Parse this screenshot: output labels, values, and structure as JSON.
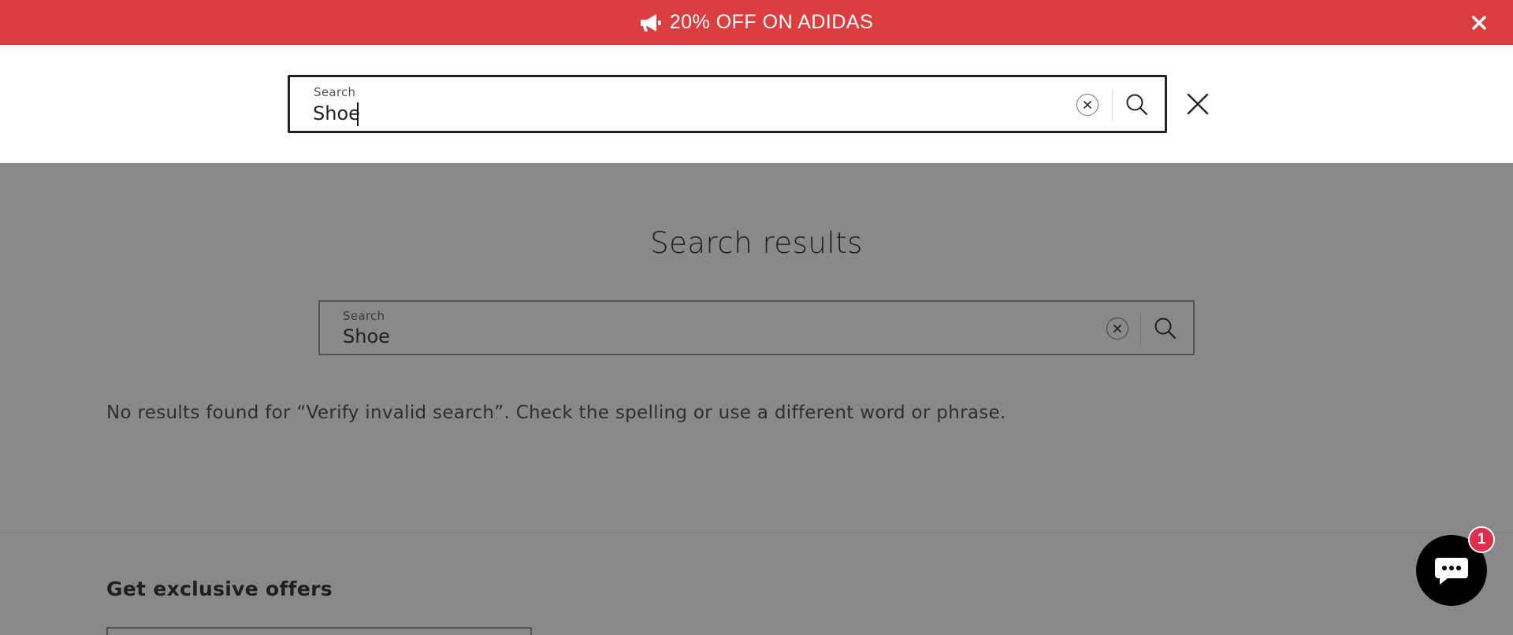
{
  "announcement": {
    "text": "20% OFF ON ADIDAS",
    "background": "#dc3e40",
    "icon": "megaphone-icon",
    "close_icon": "close-icon"
  },
  "header_search": {
    "label": "Search",
    "value": "Shoe",
    "clear_icon": "clear-circle-icon",
    "submit_icon": "search-icon",
    "close_icon": "close-icon"
  },
  "results": {
    "title": "Search results",
    "search": {
      "label": "Search",
      "value": "Shoe",
      "clear_icon": "clear-circle-icon",
      "submit_icon": "search-icon"
    },
    "message": "No results found for “Verify invalid search”. Check the spelling or use a different word or phrase."
  },
  "footer": {
    "newsletter_title": "Get exclusive offers"
  },
  "chat": {
    "icon": "chat-bubble-icon",
    "badge_count": "1",
    "badge_color": "#e02d4a"
  }
}
